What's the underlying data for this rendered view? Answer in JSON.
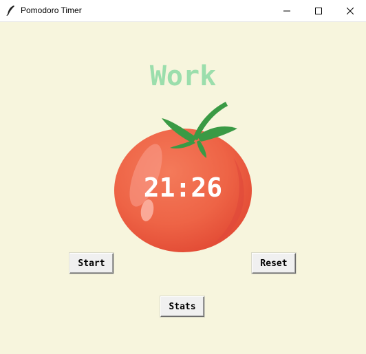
{
  "window": {
    "title": "Pomodoro Timer",
    "controls": [
      "minimize-icon",
      "maximize-icon",
      "close-icon"
    ]
  },
  "main": {
    "heading": "Work",
    "timer": "21:26"
  },
  "buttons": {
    "start_label": "Start",
    "reset_label": "Reset",
    "stats_label": "Stats"
  },
  "colors": {
    "background": "#f7f5dd",
    "heading": "#9bdeac",
    "tomato": "#e8533f",
    "leaves": "#3a9a45"
  }
}
